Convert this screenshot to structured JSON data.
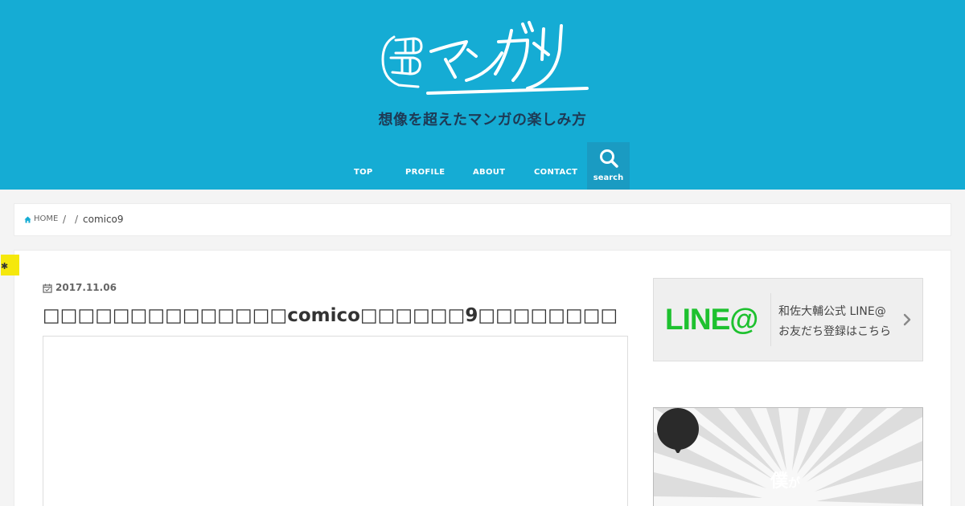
{
  "site": {
    "logo_text": "マンガタリ",
    "tagline": "想像を超えたマンガの楽しみ方",
    "brand_color": "#15acd4"
  },
  "nav": {
    "items": [
      {
        "label": "TOP"
      },
      {
        "label": "PROFILE"
      },
      {
        "label": "ABOUT"
      },
      {
        "label": "CONTACT"
      }
    ],
    "search_label": "search",
    "search_icon": "search-icon"
  },
  "breadcrumb": {
    "home_label": "HOME",
    "separator": "/",
    "current": "comico9"
  },
  "post": {
    "date": "2017.11.06",
    "title": "□□□□□□□□□□□□□□comico□□□□□□9□□□□□□□□"
  },
  "sidebar": {
    "line_banner": {
      "logo": "LINE@",
      "text1": "和佐大輔公式 LINE@",
      "text2": "お友だち登録はこちら",
      "accent": "#1ec12f"
    },
    "promo": {
      "bubble_main": "僕",
      "bubble_small": "が"
    }
  },
  "ribbon": {
    "icon": "pin-icon",
    "color": "#f5e80c"
  }
}
